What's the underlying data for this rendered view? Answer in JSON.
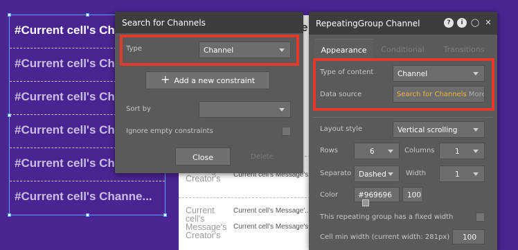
{
  "repeating_group_canvas": {
    "rows": [
      "#Current cell's Ch",
      "#Current cell's Ch",
      "#Current cell's Ch",
      "#Current cell's Ch",
      "#Current cell's Ch",
      "#Current cell's Channe..."
    ]
  },
  "page_background": {
    "header_fragment": "e",
    "message_rows": [
      {
        "creator": "Message's\nCreator's",
        "text": "Current cell's Message's C"
      },
      {
        "creator": "Current\ncell's\nMessage's\nCreator's",
        "text": "Current cell's Message'..."
      },
      {
        "creator": "",
        "text": "Current cell's Message's C"
      }
    ]
  },
  "search_panel": {
    "title": "Search for Channels",
    "type_label": "Type",
    "type_value": "Channel",
    "add_constraint_label": "Add a new constraint",
    "add_constraint_icon": "plus-icon",
    "sort_by_label": "Sort by",
    "sort_by_value": "",
    "ignore_empty_label": "Ignore empty constraints",
    "close_label": "Close",
    "delete_label": "Delete"
  },
  "property_panel": {
    "title": "RepeatingGroup Channel",
    "tools": [
      "help-icon",
      "info-icon",
      "comment-icon",
      "close-icon"
    ],
    "tabs": [
      "Appearance",
      "Conditional",
      "Transitions"
    ],
    "type_of_content_label": "Type of content",
    "type_of_content_value": "Channel",
    "data_source_label": "Data source",
    "data_source_dynamic": "Search for Channels",
    "data_source_more": "More...",
    "layout_style_label": "Layout style",
    "layout_style_value": "Vertical scrolling",
    "rows_label": "Rows",
    "rows_value": "6",
    "columns_label": "Columns",
    "columns_value": "1",
    "separator_label": "Separato",
    "separator_value": "Dashed",
    "width_label": "Width",
    "width_value": "1",
    "color_label": "Color",
    "color_value": "#969696",
    "color_opacity": "100",
    "fixed_width_label": "This repeating group has a fixed width",
    "min_width_label": "Cell min width (current width: 281px)",
    "min_width_value": "100"
  },
  "colors": {
    "highlight": "#e23b2e",
    "dynamic_text": "#f0b43c",
    "canvas_bg": "#4a2490",
    "swatch": "#969696"
  }
}
